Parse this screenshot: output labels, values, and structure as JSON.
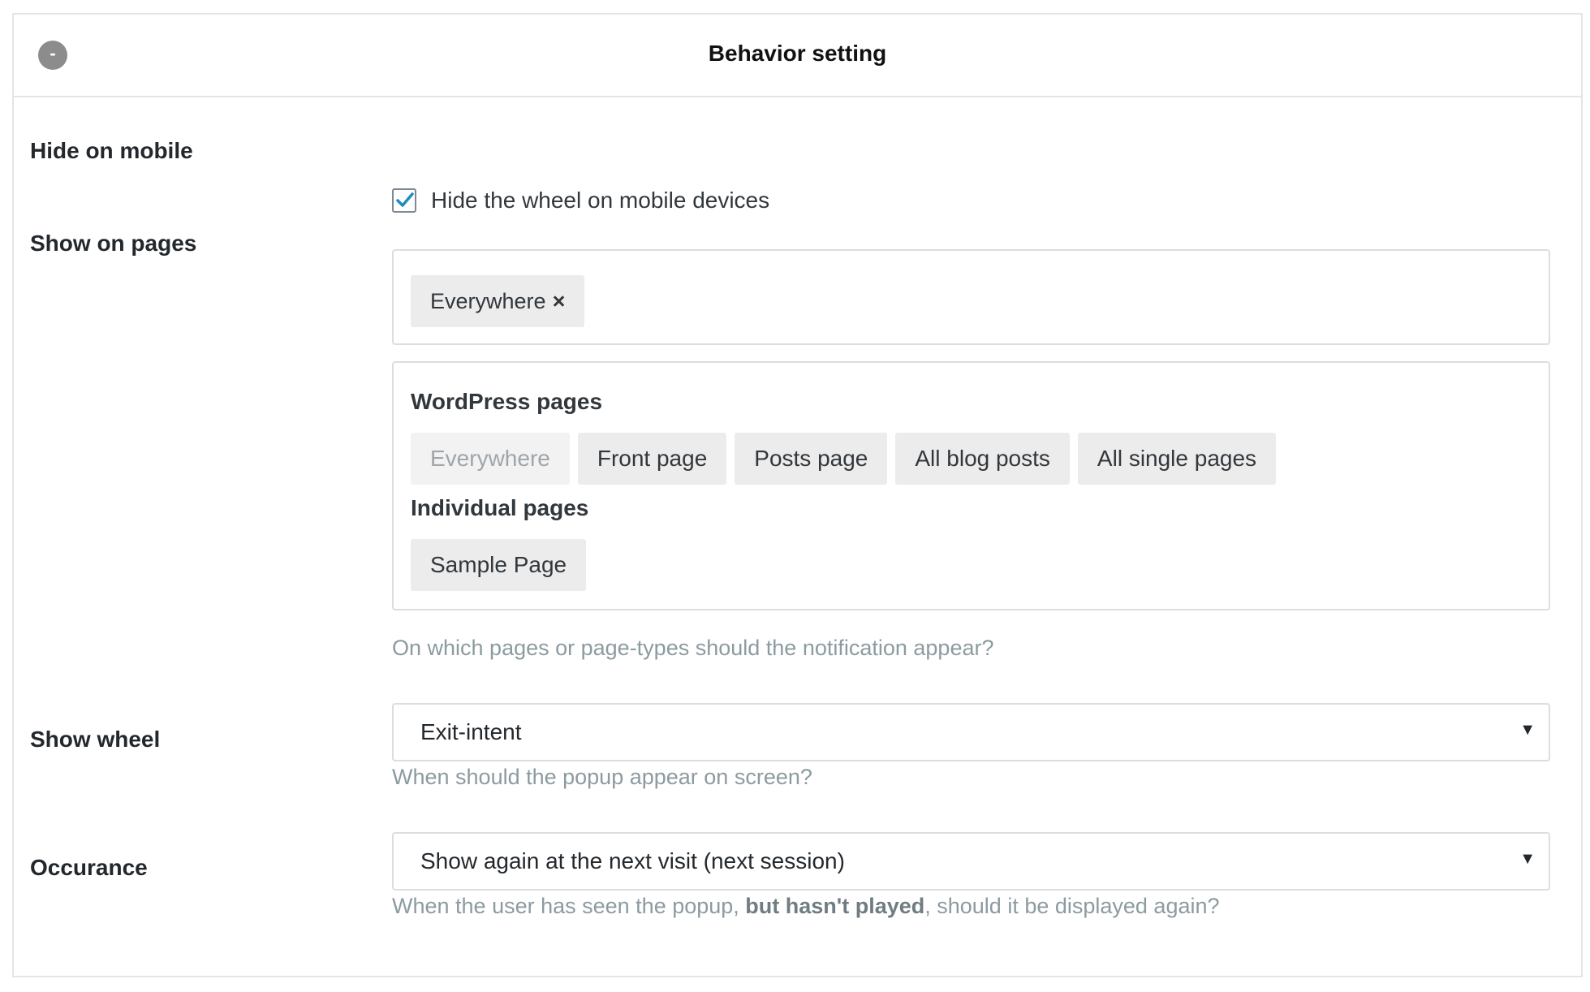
{
  "panel": {
    "title": "Behavior setting",
    "collapse_label": "-"
  },
  "hide_on_mobile": {
    "label": "Hide on mobile",
    "checkbox_label": "Hide the wheel on mobile devices",
    "checked": true
  },
  "show_on_pages": {
    "label": "Show on pages",
    "selected_tag": "Everywhere",
    "remove_glyph": "×",
    "groups": [
      {
        "title": "WordPress pages",
        "options": [
          "Everywhere",
          "Front page",
          "Posts page",
          "All blog posts",
          "All single pages"
        ]
      },
      {
        "title": "Individual pages",
        "options": [
          "Sample Page"
        ]
      }
    ],
    "help": "On which pages or page-types should the notification appear?"
  },
  "show_wheel": {
    "label": "Show wheel",
    "value": "Exit-intent",
    "caret": "▼",
    "help": "When should the popup appear on screen?"
  },
  "occurance": {
    "label": "Occurance",
    "value": "Show again at the next visit (next session)",
    "caret": "▼",
    "help_prefix": "When the user has seen the popup, ",
    "help_bold": "but hasn't played",
    "help_suffix": ", should it be displayed again?"
  },
  "colors": {
    "checkbox_check": "#1e8cbe",
    "help_text": "#8c9ba0",
    "chip_bg": "#ececec"
  }
}
